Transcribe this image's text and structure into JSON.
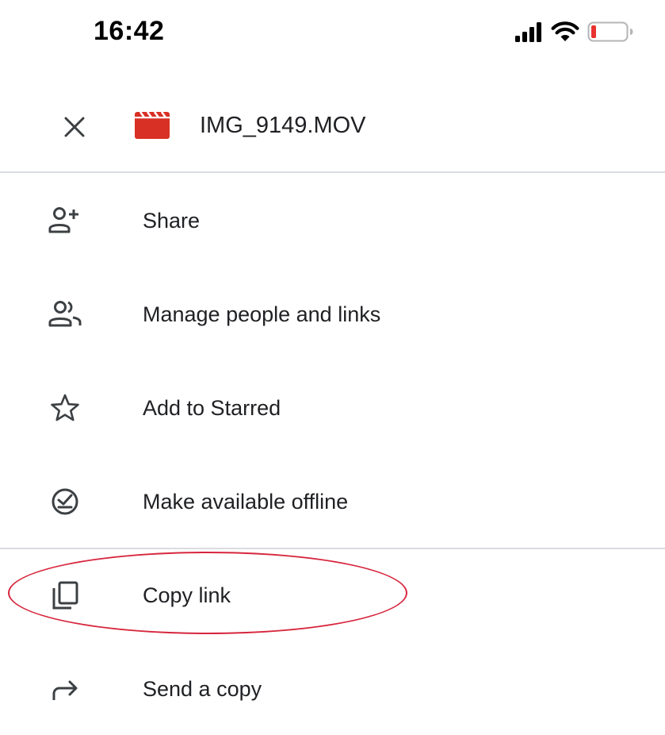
{
  "status_bar": {
    "time": "16:42",
    "battery_color": "#e8322f"
  },
  "header": {
    "file_name": "IMG_9149.MOV",
    "file_icon": "video-file-icon",
    "file_icon_color": "#d93025",
    "close_icon": "close-icon"
  },
  "menu": {
    "items": [
      {
        "label": "Share",
        "icon": "person-add-icon"
      },
      {
        "label": "Manage people and links",
        "icon": "people-icon"
      },
      {
        "label": "Add to Starred",
        "icon": "star-outline-icon"
      },
      {
        "label": "Make available offline",
        "icon": "offline-check-icon"
      },
      {
        "label": "Copy link",
        "icon": "copy-icon"
      },
      {
        "label": "Send a copy",
        "icon": "forward-arrow-icon"
      }
    ]
  },
  "annotation": {
    "highlight_color": "#d7263d",
    "highlighted_item": "Copy link"
  }
}
